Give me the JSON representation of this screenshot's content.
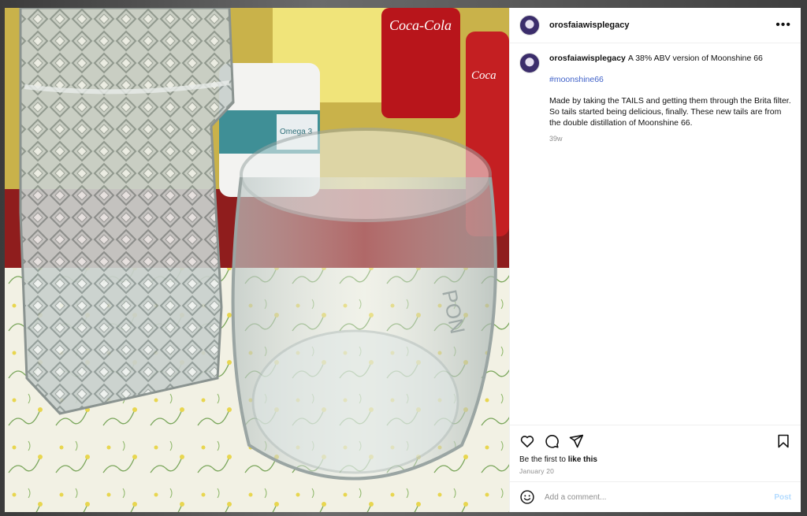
{
  "post": {
    "username": "orosfaiawisplegacy",
    "caption_lead": "A 38% ABV version of Moonshine 66",
    "hashtag": "#moonshine66",
    "description": "Made by taking the TAILS and getting them through the Brita filter. So tails started being delicious, finally. These new tails are from the double distillation of Moonshine 66.",
    "age": "39w",
    "likes_prefix": "Be the first to",
    "likes_action": "like this",
    "date": "January 20"
  },
  "header": {
    "more_label": "•••"
  },
  "comment_box": {
    "placeholder": "Add a comment...",
    "post_label": "Post"
  },
  "photo": {
    "jar_label": "Omega 3",
    "glass_etch": "PON"
  },
  "icons": {
    "like": "heart-icon",
    "comment": "comment-bubble-icon",
    "share": "paper-plane-icon",
    "save": "bookmark-icon",
    "emoji": "emoji-smile-icon",
    "more": "more-options-icon"
  },
  "colors": {
    "hashtag": "#4062c9",
    "post_button": "#b3dbff",
    "muted": "#8e8e8e"
  }
}
